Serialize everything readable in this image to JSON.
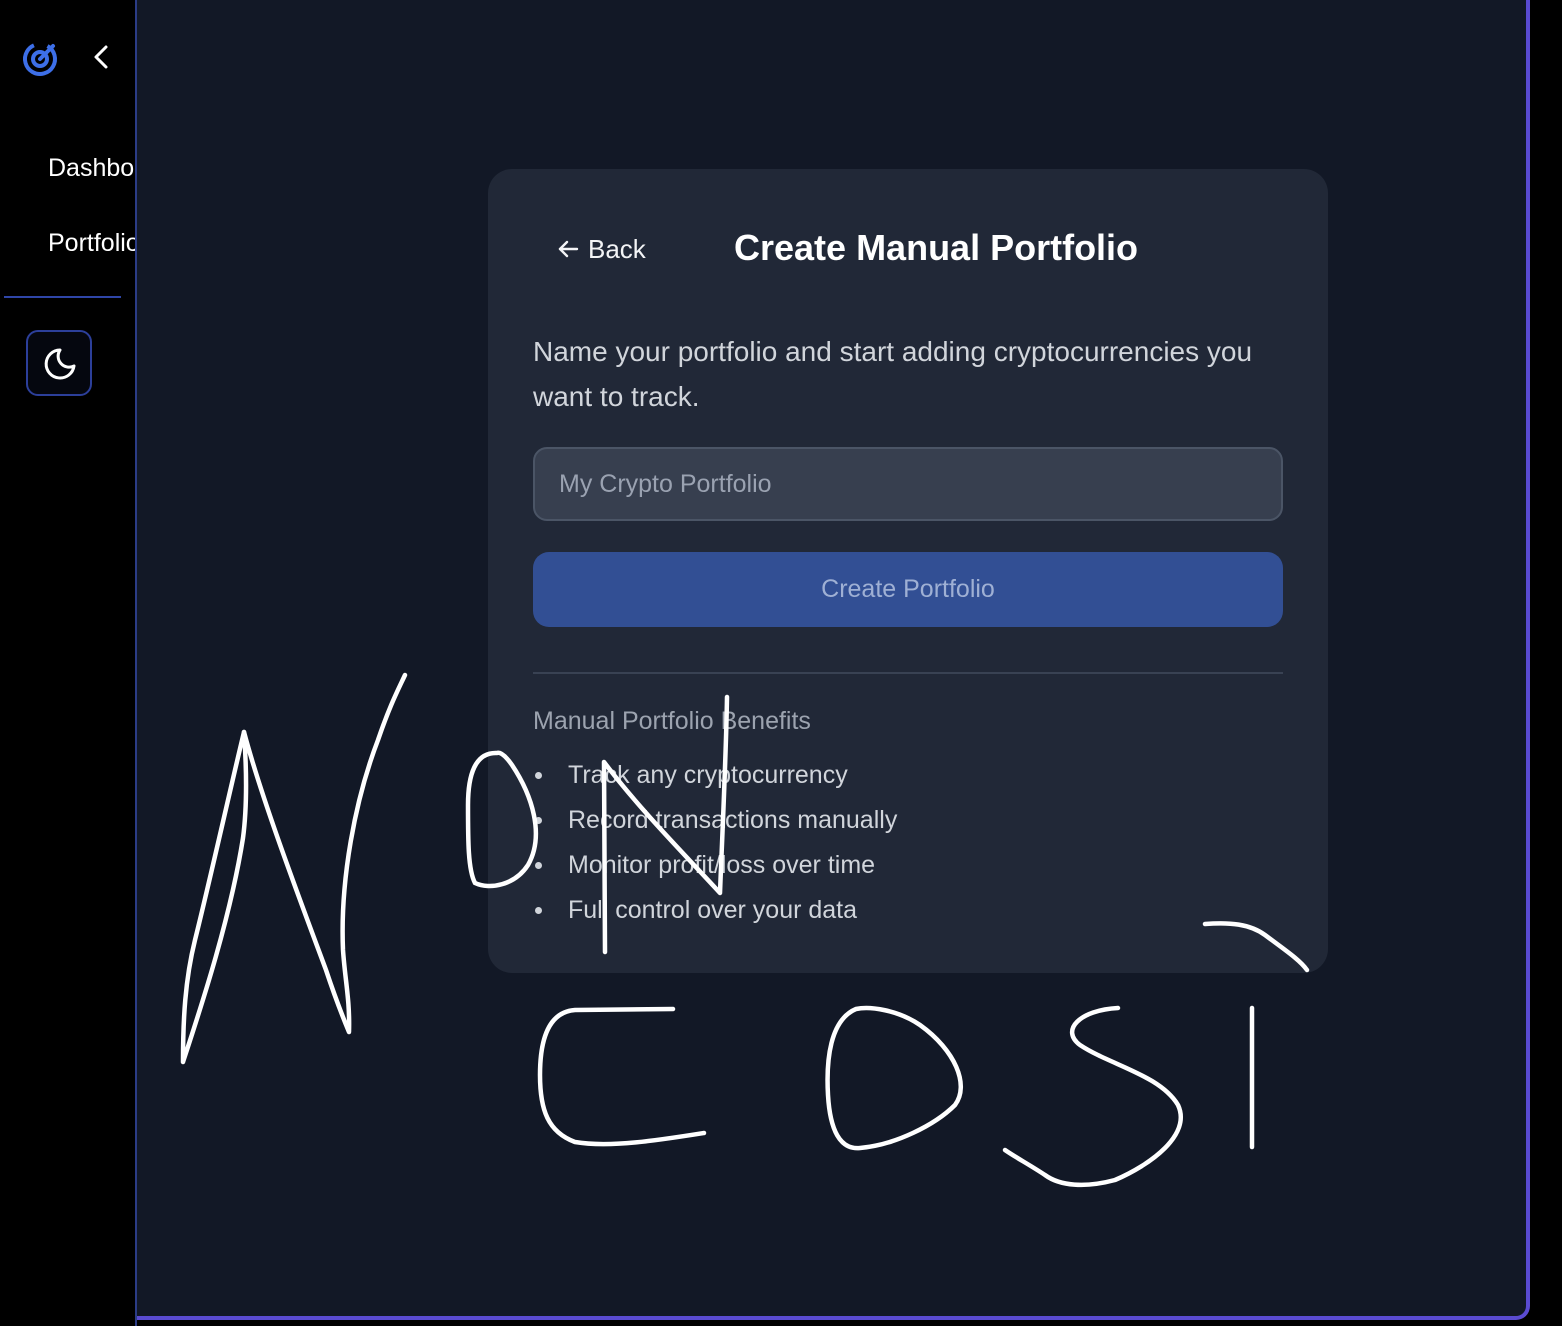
{
  "sidebar": {
    "logo_icon": "target-logo-icon",
    "collapse_icon": "chevron-left-icon",
    "items": [
      {
        "label": "Dashboard"
      },
      {
        "label": "Portfolio"
      }
    ],
    "theme_toggle_icon": "moon-icon"
  },
  "card": {
    "back_label": "Back",
    "back_icon": "arrow-left-icon",
    "title": "Create Manual Portfolio",
    "description": "Name your portfolio and start adding cryptocurrencies you want to track.",
    "input": {
      "value": "",
      "placeholder": "My Crypto Portfolio"
    },
    "create_button": "Create Portfolio",
    "benefits": {
      "title": "Manual Portfolio Benefits",
      "items": [
        "Track any cryptocurrency",
        "Record transactions manually",
        "Monitor profit/loss over time",
        "Full control over your data"
      ]
    }
  },
  "annotation": {
    "handwritten_text": "NON COSI"
  },
  "colors": {
    "accent": "#3b6ee0",
    "page_background": "#121826",
    "card_background": "#212837",
    "button_background": "#324f94",
    "frame_border": "#5a4bd1"
  }
}
